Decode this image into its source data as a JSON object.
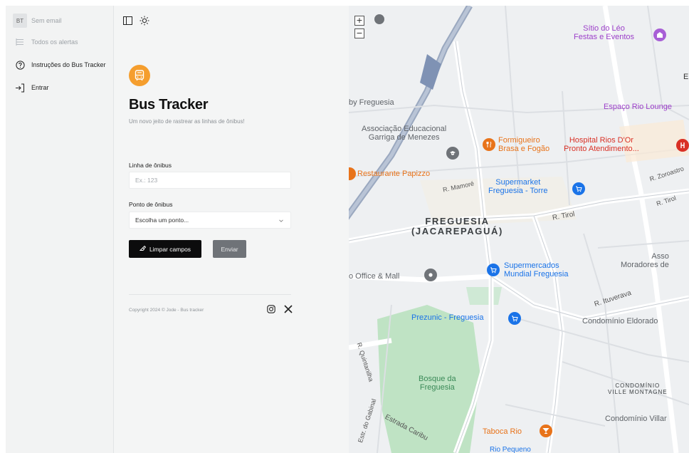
{
  "sidebar": {
    "items": [
      {
        "label": "Sem email",
        "icon": "user-initials-avatar",
        "avatar": "BT"
      },
      {
        "label": "Todos os alertas",
        "icon": "list-icon"
      },
      {
        "label": "Instruções do Bus Tracker",
        "icon": "question-circle-icon"
      },
      {
        "label": "Entrar",
        "icon": "login-icon"
      }
    ]
  },
  "toolbar": {
    "icons": [
      "sidebar-toggle-icon",
      "sun-icon"
    ]
  },
  "app": {
    "icon": "bus-icon",
    "brand_color": "#f59e2e",
    "title": "Bus Tracker",
    "subtitle": "Um novo jeito de rastrear as linhas de ônibus!"
  },
  "form": {
    "line_label": "Linha de ônibus",
    "line_placeholder": "Ex.: 123",
    "line_value": "",
    "stop_label": "Ponto de ônibus",
    "stop_selected": "Escolha um ponto...",
    "clear_label": "Limpar campos",
    "send_label": "Enviar"
  },
  "footer": {
    "copyright": "Copyright 2024 © Jode - Bus tracker",
    "social": [
      "instagram-icon",
      "x-icon"
    ]
  },
  "map": {
    "zoom_in": "+",
    "zoom_out": "−",
    "labels": {
      "sitio": "Sítio do Léo\nFestas e Eventos",
      "freguesia_left": "by Freguesia",
      "associacao": "Associação Educacional\nGarriga de Menezes",
      "formigueiro": "Formigueiro\nBrasa e Fogão",
      "hospital": "Hospital Rios D'Or\nPronto Atendimento...",
      "espaco": "Espaço Rio Lounge",
      "restaurante": "Restaurante Papizzo",
      "mamore": "R. Mamoré",
      "supermarket": "Supermarket\nFreguesia - Torre",
      "zoroastro": "R. Zoroastro",
      "tirol1": "R. Tirol",
      "tirol2": "R. Tirol",
      "bairro": "FREGUESIA\n(JACAREPAGUÁ)",
      "office": "o Office & Mall",
      "mundial": "Supermercados\nMundial Freguesia",
      "associacao_moradores": "Asso\nMoradores de",
      "ituverava": "R. Ituverava",
      "prezunic": "Prezunic - Freguesia",
      "eldorado": "Condomínio Eldorado",
      "quintanilha": "R. Quintanilha",
      "bosque": "Bosque da\nFreguesia",
      "ville": "CONDOMÍNIO\nVILLE MONTAGNE",
      "villar": "Condomínio Villar",
      "gabinal": "Estr. do Gabinal",
      "caribu": "Estrada Caribu",
      "taboca": "Taboca Rio",
      "rio_pequeno": "Rio Pequeno",
      "edge_e": "E"
    }
  }
}
